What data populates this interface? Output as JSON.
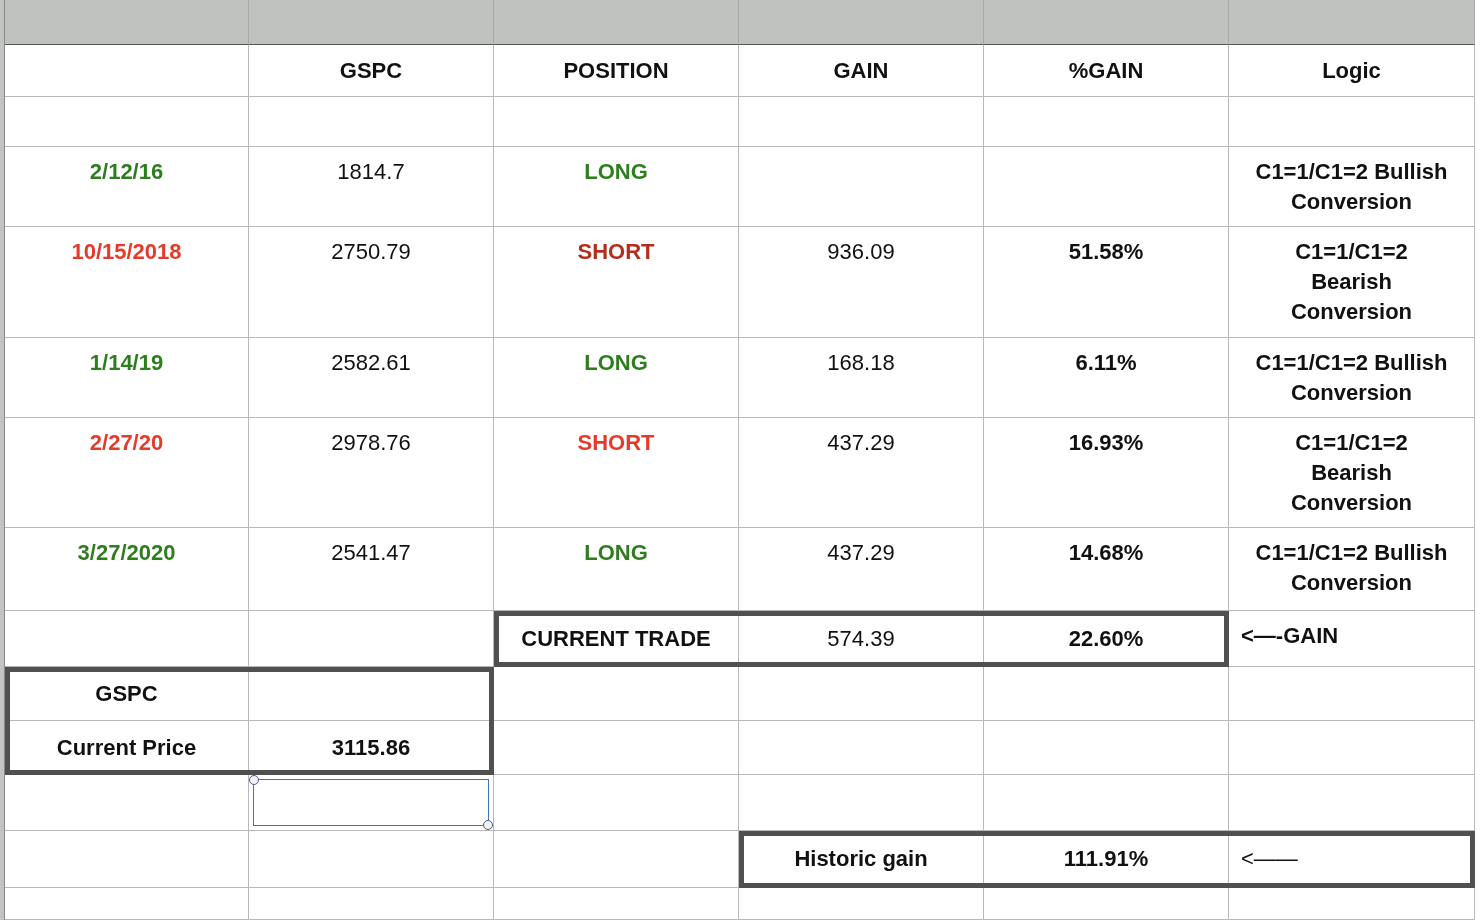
{
  "table": {
    "columns": [
      "GSPC",
      "POSITION",
      "GAIN",
      "%GAIN",
      "Logic"
    ],
    "trades": [
      {
        "date": {
          "text": "2/12/16",
          "color": "#2e7d1e"
        },
        "gspc": "1814.7",
        "position": {
          "text": "LONG",
          "color": "#2e7d1e"
        },
        "logic": "C1=1/C1=2 Bullish\nConversion"
      },
      {
        "date": {
          "text": "10/15/2018",
          "color": "#e53b2a"
        },
        "gspc": "2750.79",
        "position": {
          "text": "SHORT",
          "color": "#b52d1c"
        },
        "gain": "936.09",
        "pct_gain": "51.58%",
        "logic": "C1=1/C1=2\nBearish\nConversion"
      },
      {
        "date": {
          "text": "1/14/19",
          "color": "#2e7d1e"
        },
        "gspc": "2582.61",
        "position": {
          "text": "LONG",
          "color": "#2e7d1e"
        },
        "gain": "168.18",
        "pct_gain": "6.11%",
        "logic": "C1=1/C1=2 Bullish\nConversion"
      },
      {
        "date": {
          "text": "2/27/20",
          "color": "#e53b2a"
        },
        "gspc": "2978.76",
        "position": {
          "text": "SHORT",
          "color": "#e53b2a"
        },
        "gain": "437.29",
        "pct_gain": "16.93%",
        "logic": "C1=1/C1=2\nBearish\nConversion"
      },
      {
        "date": {
          "text": "3/27/2020",
          "color": "#2e7d1e"
        },
        "gspc": "2541.47",
        "position": {
          "text": "LONG",
          "color": "#2e7d1e"
        },
        "gain": "437.29",
        "pct_gain": "14.68%",
        "logic": "C1=1/C1=2 Bullish\nConversion"
      }
    ]
  },
  "current_trade": {
    "label": "CURRENT TRADE",
    "gain": "574.39",
    "pct_gain": "22.60%",
    "note": "<—-GAIN"
  },
  "price_box": {
    "title": "GSPC",
    "label": "Current Price",
    "value": "3115.86",
    "cell_below_selected": true
  },
  "historic": {
    "label": "Historic gain",
    "value": "111.91%",
    "note": "<——"
  }
}
